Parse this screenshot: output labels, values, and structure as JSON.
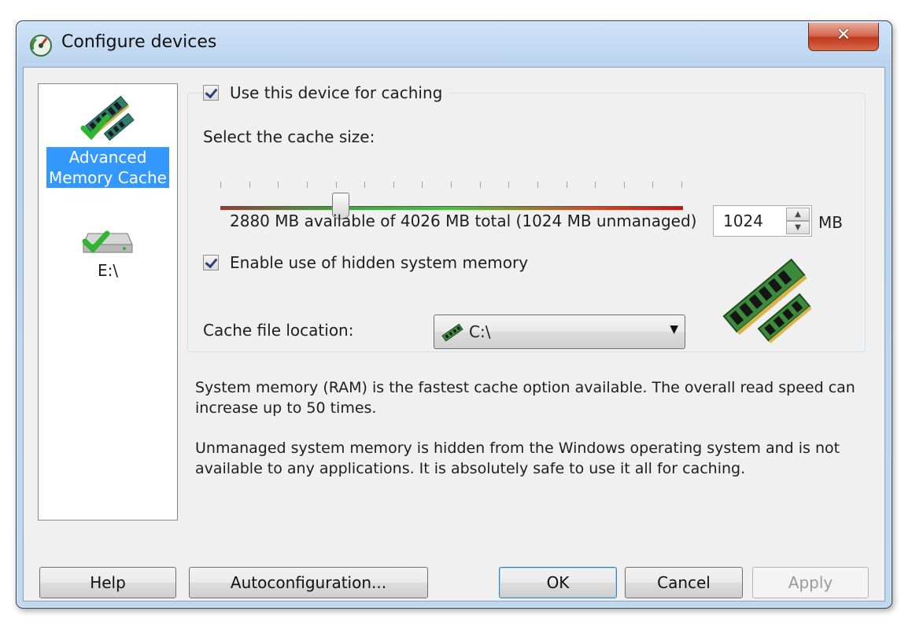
{
  "window": {
    "title": "Configure devices",
    "close_glyph": "✕"
  },
  "sidebar": {
    "items": [
      {
        "label_line1": "Advanced",
        "label_line2": "Memory Cache",
        "icon": "ram-check-icon",
        "selected": true
      },
      {
        "label": "E:\\",
        "icon": "drive-check-icon",
        "selected": false
      }
    ]
  },
  "main": {
    "use_device_label": "Use this device for caching",
    "use_device_checked": true,
    "cache_size_label": "Select the cache size:",
    "cache_size_value": "1024",
    "cache_size_unit": "MB",
    "slider_fraction": 0.26,
    "availability_text": "2880 MB available of 4026 MB total (1024 MB unmanaged)",
    "hidden_memory_label": "Enable use of hidden system memory",
    "hidden_memory_checked": true,
    "cache_location_label": "Cache file location:",
    "cache_location_value": "C:\\",
    "description_1": "System memory (RAM) is the fastest cache option available. The overall read speed can increase up to 50 times.",
    "description_2": "Unmanaged system memory is hidden from the Windows operating system and is not available to any applications. It is absolutely safe to use it all for caching."
  },
  "buttons": {
    "help": "Help",
    "autoconfig": "Autoconfiguration...",
    "ok": "OK",
    "cancel": "Cancel",
    "apply": "Apply",
    "apply_enabled": false
  },
  "colors": {
    "selection": "#3399ff",
    "slider_red": "#d10f0f",
    "slider_green": "#43c63a"
  }
}
